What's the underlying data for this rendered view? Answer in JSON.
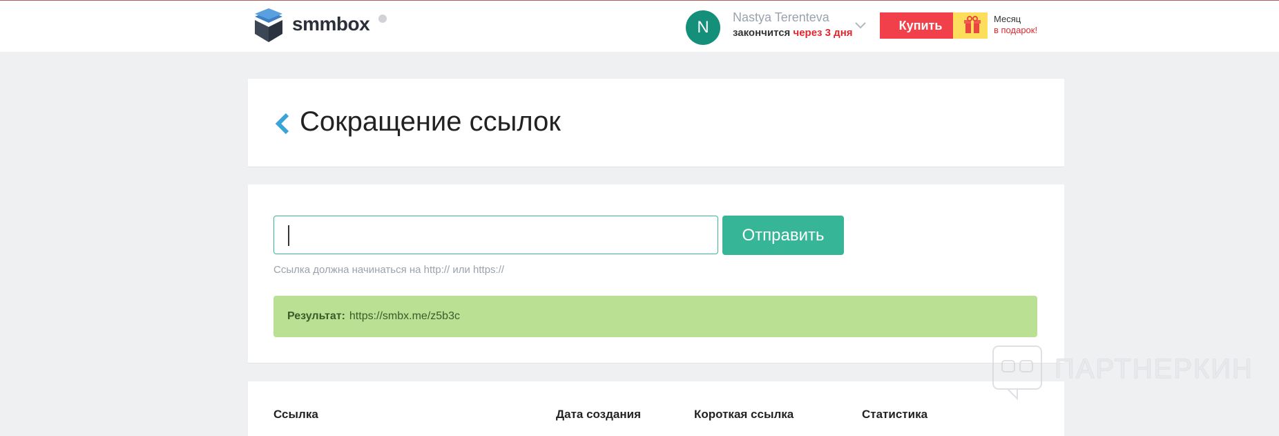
{
  "header": {
    "logo_text": "smmbox",
    "avatar_initial": "N",
    "user_name": "Nastya Terenteva",
    "expire_prefix": "закончится",
    "expire_time": "через 3 дня",
    "buy_label": "Купить",
    "gift_line1": "Месяц",
    "gift_line2": "в подарок!"
  },
  "page": {
    "title": "Сокращение ссылок"
  },
  "form": {
    "input_value": "",
    "submit_label": "Отправить",
    "hint": "Ссылка должна начинаться на http:// или https://"
  },
  "result": {
    "label": "Результат:",
    "value": "https://smbx.me/z5b3c"
  },
  "table": {
    "columns": [
      "Ссылка",
      "Дата создания",
      "Короткая ссылка",
      "Статистика"
    ]
  },
  "watermark": {
    "text": "ПАРТНЕРКИН"
  },
  "colors": {
    "accent": "#36b597",
    "buy": "#f2404a",
    "gift": "#fcde5c",
    "result_bg": "#b9e093",
    "avatar": "#148f7a",
    "warning": "#e3262e"
  }
}
